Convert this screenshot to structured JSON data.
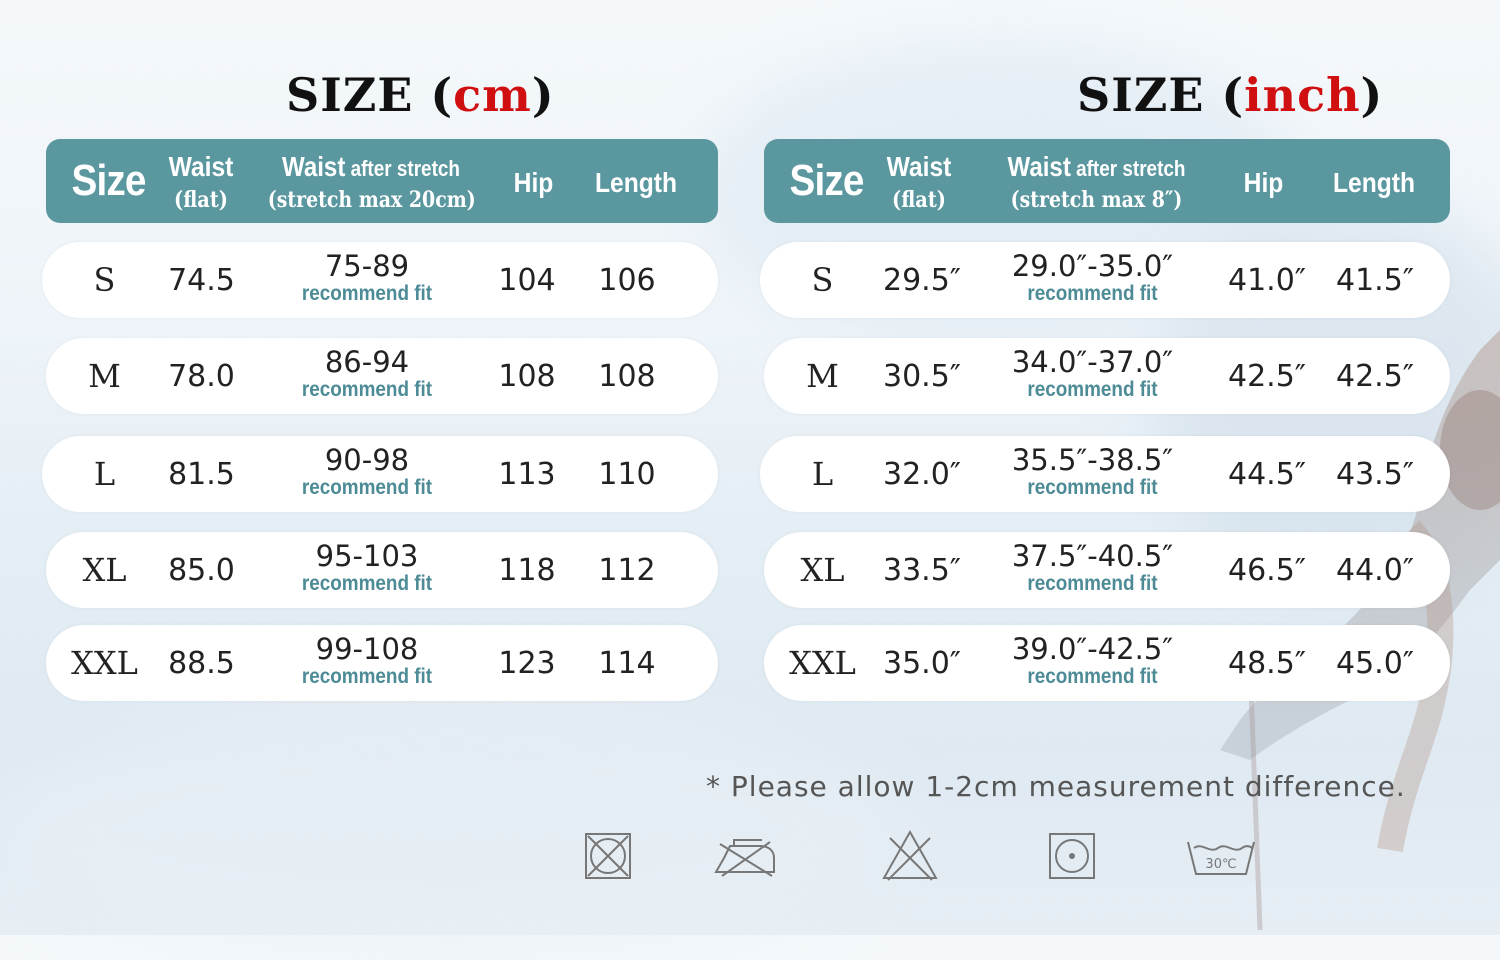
{
  "cm_table": {
    "title_main": "SIZE",
    "title_unit": "cm",
    "headers": {
      "size": "Size",
      "waist": "Waist",
      "waist_sub": "(flat)",
      "waist_stretch": "Waist",
      "waist_stretch_small": " after stretch",
      "waist_stretch_sub": "(stretch max 20cm)",
      "hip": "Hip",
      "length": "Length"
    },
    "rows": [
      {
        "size": "S",
        "waist": "74.5",
        "stretch": "75-89",
        "note": "recommend fit",
        "hip": "104",
        "length": "106"
      },
      {
        "size": "M",
        "waist": "78.0",
        "stretch": "86-94",
        "note": "recommend fit",
        "hip": "108",
        "length": "108"
      },
      {
        "size": "L",
        "waist": "81.5",
        "stretch": "90-98",
        "note": "recommend fit",
        "hip": "113",
        "length": "110"
      },
      {
        "size": "XL",
        "waist": "85.0",
        "stretch": "95-103",
        "note": "recommend fit",
        "hip": "118",
        "length": "112"
      },
      {
        "size": "XXL",
        "waist": "88.5",
        "stretch": "99-108",
        "note": "recommend fit",
        "hip": "123",
        "length": "114"
      }
    ]
  },
  "inch_table": {
    "title_main": "SIZE",
    "title_unit": "inch",
    "headers": {
      "size": "Size",
      "waist": "Waist",
      "waist_sub": "(flat)",
      "waist_stretch": "Waist",
      "waist_stretch_small": " after stretch",
      "waist_stretch_sub": "(stretch max 8″)",
      "hip": "Hip",
      "length": "Length"
    },
    "rows": [
      {
        "size": "S",
        "waist": "29.5″",
        "stretch": "29.0″-35.0″",
        "note": "recommend fit",
        "hip": "41.0″",
        "length": "41.5″"
      },
      {
        "size": "M",
        "waist": "30.5″",
        "stretch": "34.0″-37.0″",
        "note": "recommend fit",
        "hip": "42.5″",
        "length": "42.5″"
      },
      {
        "size": "L",
        "waist": "32.0″",
        "stretch": "35.5″-38.5″",
        "note": "recommend fit",
        "hip": "44.5″",
        "length": "43.5″"
      },
      {
        "size": "XL",
        "waist": "33.5″",
        "stretch": "37.5″-40.5″",
        "note": "recommend fit",
        "hip": "46.5″",
        "length": "44.0″"
      },
      {
        "size": "XXL",
        "waist": "35.0″",
        "stretch": "39.0″-42.5″",
        "note": "recommend fit",
        "hip": "48.5″",
        "length": "45.0″"
      }
    ]
  },
  "footnote": "* Please allow 1-2cm measurement difference.",
  "care_icons": [
    {
      "icon": "do-not-tumble-dry-icon"
    },
    {
      "icon": "do-not-iron-icon"
    },
    {
      "icon": "do-not-bleach-icon"
    },
    {
      "icon": "dry-clean-icon"
    },
    {
      "icon": "wash-30c-icon",
      "label": "30℃"
    }
  ],
  "colors": {
    "header": "#5a979f",
    "accent_red": "#d01010",
    "recommend_text": "#4d8b96"
  }
}
